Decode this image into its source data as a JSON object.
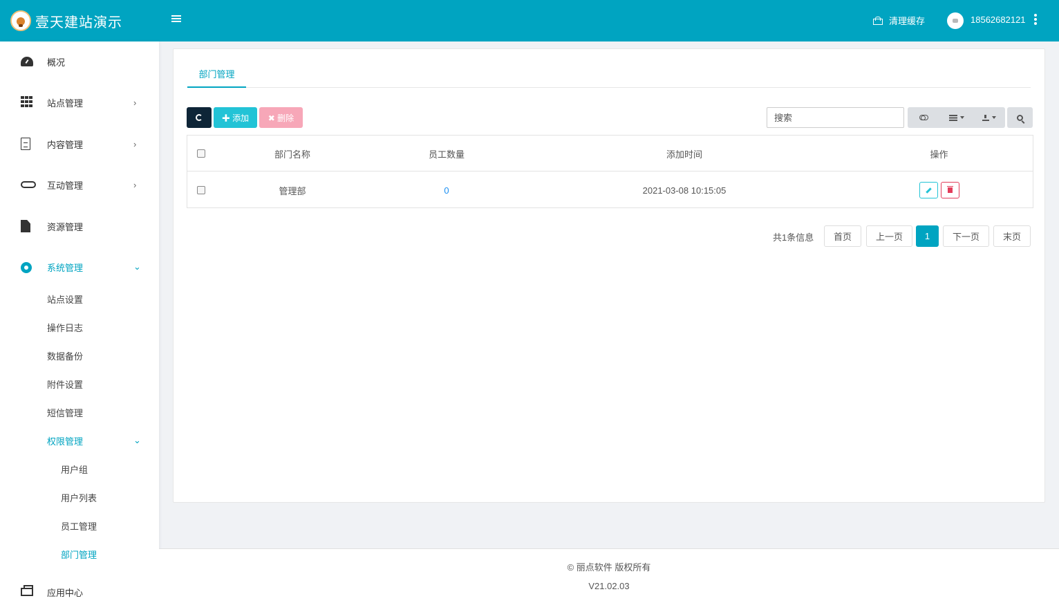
{
  "topbar": {
    "brand_name": "壹天建站演示",
    "clear_cache_label": "清理缓存",
    "user_phone": "18562682121",
    "accent_color": "#00a4c1"
  },
  "sidebar": {
    "items": [
      {
        "label": "概况",
        "icon": "dashboard-icon"
      },
      {
        "label": "站点管理",
        "icon": "grid-icon",
        "arrow": "›"
      },
      {
        "label": "内容管理",
        "icon": "document-icon",
        "arrow": "›"
      },
      {
        "label": "互动管理",
        "icon": "handshake-icon",
        "arrow": "›"
      },
      {
        "label": "资源管理",
        "icon": "file-icon"
      },
      {
        "label": "系统管理",
        "icon": "gear-icon",
        "arrow": "⌄"
      },
      {
        "label": "应用中心",
        "icon": "box-icon"
      }
    ],
    "system_sub": [
      {
        "label": "站点设置"
      },
      {
        "label": "操作日志"
      },
      {
        "label": "数据备份"
      },
      {
        "label": "附件设置"
      },
      {
        "label": "短信管理"
      },
      {
        "label": "权限管理",
        "arrow": "⌄"
      }
    ],
    "permission_sub": [
      {
        "label": "用户组"
      },
      {
        "label": "用户列表"
      },
      {
        "label": "员工管理"
      },
      {
        "label": "部门管理"
      }
    ]
  },
  "main": {
    "tab_label": "部门管理",
    "toolbar": {
      "add_label": "✚ 添加",
      "delete_label": "✖ 删除",
      "search_placeholder": "搜索"
    },
    "table": {
      "headers": [
        "部门名称",
        "员工数量",
        "添加时间",
        "操作"
      ],
      "rows": [
        {
          "name": "管理部",
          "count": "0",
          "time": "2021-03-08 10:15:05"
        }
      ]
    },
    "pagination": {
      "info": "共1条信息",
      "first": "首页",
      "prev": "上一页",
      "current": "1",
      "next": "下一页",
      "last": "末页"
    }
  },
  "footer": {
    "copyright": "© 丽点软件 版权所有",
    "version": "V21.02.03"
  }
}
